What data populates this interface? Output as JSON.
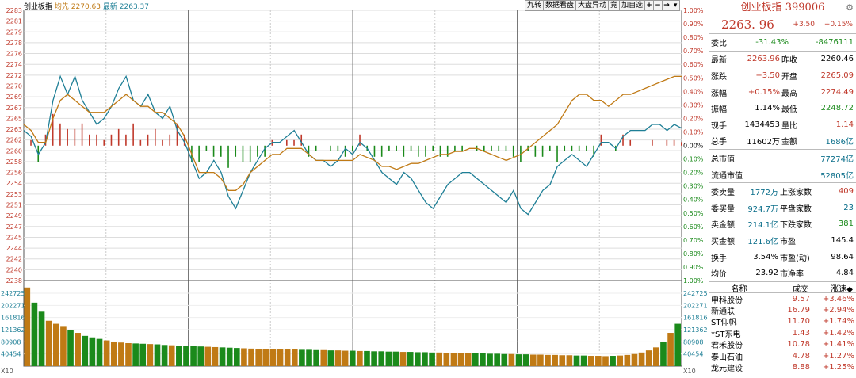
{
  "header": {
    "name_label": "创业板指",
    "avg_label": "均先",
    "avg_value": "2270.63",
    "last_label": "最新",
    "last_value": "2263.37"
  },
  "toolbar": {
    "items": [
      "九转",
      "数据看盘",
      "大盘异动",
      "竞",
      "加自选",
      "+",
      "−",
      "→",
      "▾"
    ]
  },
  "price_axis": {
    "left_labels": [
      "2283",
      "2281",
      "2279",
      "2278",
      "2276",
      "2274",
      "2272",
      "2270",
      "2269",
      "2267",
      "2265",
      "2263",
      "2262",
      "2260",
      "2258",
      "2256",
      "2254",
      "2253",
      "2251",
      "2249",
      "2247",
      "2245",
      "2244",
      "2242",
      "2240",
      "2238"
    ],
    "right_labels": [
      "1.00%",
      "0.90%",
      "0.80%",
      "0.70%",
      "0.60%",
      "0.50%",
      "0.40%",
      "0.30%",
      "0.20%",
      "0.10%",
      "0.00%",
      "0.10%",
      "0.20%",
      "0.30%",
      "0.40%",
      "0.50%",
      "0.60%",
      "0.70%",
      "0.80%",
      "0.90%",
      "1.00%"
    ]
  },
  "volume_axis": {
    "labels": [
      "242725",
      "202271",
      "161816",
      "121362",
      "80908",
      "40454"
    ],
    "unit_left": "X10",
    "unit_right": "X10"
  },
  "chart_data": {
    "type": "line",
    "pre_close": 2260.46,
    "ylim": [
      2238,
      2283
    ],
    "series": [
      {
        "name": "最新",
        "color": "#1e7f96",
        "values": [
          2263.0,
          2262.0,
          2259.0,
          2261.0,
          2268.0,
          2272.0,
          2269.0,
          2272.0,
          2268.0,
          2266.0,
          2264.0,
          2265.0,
          2267.0,
          2270.0,
          2272.0,
          2268.0,
          2267.0,
          2269.0,
          2266.0,
          2265.0,
          2267.0,
          2263.0,
          2261.0,
          2258.0,
          2255.0,
          2256.0,
          2258.0,
          2256.0,
          2252.0,
          2250.0,
          2253.0,
          2256.0,
          2258.0,
          2260.0,
          2261.0,
          2261.0,
          2262.0,
          2263.0,
          2261.0,
          2259.0,
          2258.0,
          2258.0,
          2257.0,
          2258.0,
          2260.0,
          2259.0,
          2261.0,
          2260.0,
          2258.0,
          2256.0,
          2255.0,
          2254.0,
          2256.0,
          2255.0,
          2253.0,
          2251.0,
          2250.0,
          2252.0,
          2254.0,
          2255.0,
          2256.0,
          2256.0,
          2255.0,
          2254.0,
          2253.0,
          2252.0,
          2251.0,
          2253.0,
          2250.0,
          2249.0,
          2251.0,
          2253.0,
          2254.0,
          2257.0,
          2258.0,
          2259.0,
          2258.0,
          2257.0,
          2259.0,
          2261.0,
          2261.0,
          2260.0,
          2262.0,
          2263.0,
          2263.0,
          2263.0,
          2264.0,
          2264.0,
          2263.0,
          2264.0,
          2263.37
        ]
      },
      {
        "name": "均先",
        "color": "#c07a15",
        "values": [
          2264.0,
          2263.0,
          2261.0,
          2261.0,
          2265.0,
          2268.0,
          2269.0,
          2268.0,
          2267.0,
          2266.0,
          2266.0,
          2266.0,
          2267.0,
          2268.0,
          2269.0,
          2268.0,
          2267.0,
          2267.0,
          2266.0,
          2266.0,
          2265.0,
          2264.0,
          2262.0,
          2259.0,
          2256.0,
          2256.0,
          2256.0,
          2255.0,
          2253.0,
          2253.0,
          2254.0,
          2256.0,
          2257.0,
          2258.0,
          2259.0,
          2259.0,
          2260.0,
          2260.0,
          2260.0,
          2259.0,
          2258.0,
          2258.0,
          2258.0,
          2258.0,
          2258.0,
          2258.0,
          2259.0,
          2258.5,
          2258.0,
          2257.0,
          2257.0,
          2256.5,
          2257.0,
          2257.5,
          2257.5,
          2258.0,
          2258.5,
          2259.0,
          2259.0,
          2259.5,
          2259.5,
          2260.0,
          2260.0,
          2259.5,
          2259.0,
          2258.5,
          2258.0,
          2258.5,
          2259.0,
          2260.0,
          2261.0,
          2262.0,
          2263.0,
          2264.0,
          2266.0,
          2268.0,
          2269.0,
          2269.0,
          2268.0,
          2268.0,
          2267.0,
          2268.0,
          2269.0,
          2269.0,
          2269.5,
          2270.0,
          2270.5,
          2271.0,
          2271.5,
          2272.0,
          2272.0
        ]
      }
    ],
    "volume_values": [
      260000,
      210000,
      180000,
      150000,
      140000,
      130000,
      120000,
      110000,
      100000,
      95000,
      90000,
      85000,
      80000,
      78000,
      76000,
      75000,
      74000,
      73000,
      72000,
      70000,
      69000,
      68000,
      67000,
      66000,
      65000,
      64000,
      63000,
      62000,
      61000,
      60000,
      59000,
      58000,
      57000,
      57000,
      56000,
      56000,
      55000,
      55000,
      54000,
      54000,
      53000,
      53000,
      52000,
      52000,
      51000,
      51000,
      50000,
      50000,
      49000,
      49000,
      48000,
      48000,
      47000,
      47000,
      46000,
      46000,
      45000,
      45000,
      44000,
      44000,
      43000,
      43000,
      42000,
      42000,
      41000,
      41000,
      40000,
      40000,
      39000,
      39000,
      38000,
      38000,
      37000,
      37000,
      36000,
      36000,
      35000,
      35000,
      34000,
      34000,
      33000,
      34000,
      35000,
      37000,
      40000,
      45000,
      52000,
      62000,
      80000,
      110000,
      140000
    ],
    "ylim_volume": [
      0,
      283000
    ]
  },
  "panel": {
    "title": "创业板指 399006",
    "price": "2263. 96",
    "change": "+3.50",
    "change_pct": "+0.15%",
    "wei_label": "委比",
    "wei_pct": "-31.43%",
    "wei_diff": "-8476111",
    "stats": [
      {
        "l1": "最新",
        "v1": "2263.96",
        "c1": "red",
        "l2": "昨收",
        "v2": "2260.46",
        "c2": "blk"
      },
      {
        "l1": "涨跌",
        "v1": "+3.50",
        "c1": "red",
        "l2": "开盘",
        "v2": "2265.09",
        "c2": "red"
      },
      {
        "l1": "涨幅",
        "v1": "+0.15%",
        "c1": "red",
        "l2": "最高",
        "v2": "2274.49",
        "c2": "red"
      },
      {
        "l1": "振幅",
        "v1": "1.14%",
        "c1": "blk",
        "l2": "最低",
        "v2": "2248.72",
        "c2": "green"
      },
      {
        "l1": "现手",
        "v1": "1434453",
        "c1": "blk",
        "l2": "量比",
        "v2": "1.14",
        "c2": "red"
      },
      {
        "l1": "总手",
        "v1": "11602万",
        "c1": "blk",
        "l2": "金额",
        "v2": "1686亿",
        "c2": "teal"
      }
    ],
    "cap": [
      {
        "l": "总市值",
        "v": "77274亿"
      },
      {
        "l": "流通市值",
        "v": "52805亿"
      }
    ],
    "stats2": [
      {
        "l1": "委卖量",
        "v1": "1772万",
        "c1": "teal",
        "l2": "上涨家数",
        "v2": "409",
        "c2": "red"
      },
      {
        "l1": "委买量",
        "v1": "924.7万",
        "c1": "teal",
        "l2": "平盘家数",
        "v2": "23",
        "c2": "teal"
      },
      {
        "l1": "卖金额",
        "v1": "214.1亿",
        "c1": "teal",
        "l2": "下跌家数",
        "v2": "381",
        "c2": "green"
      },
      {
        "l1": "买金额",
        "v1": "121.6亿",
        "c1": "teal",
        "l2": "市盈",
        "v2": "145.4",
        "c2": "blk"
      },
      {
        "l1": "换手",
        "v1": "3.54%",
        "c1": "blk",
        "l2": "市盈(动)",
        "v2": "98.64",
        "c2": "blk"
      },
      {
        "l1": "均价",
        "v1": "23.92",
        "c1": "blk",
        "l2": "市净率",
        "v2": "4.84",
        "c2": "blk"
      }
    ],
    "list_head": {
      "name": "名称",
      "price": "成交",
      "change": "涨速◆"
    },
    "list": [
      {
        "name": "申科股份",
        "price": "9.57",
        "change": "+3.46%"
      },
      {
        "name": "新通联",
        "price": "16.79",
        "change": "+2.94%"
      },
      {
        "name": "ST仰帆",
        "price": "11.70",
        "change": "+1.74%"
      },
      {
        "name": "*ST东电",
        "price": "1.43",
        "change": "+1.42%"
      },
      {
        "name": "君禾股份",
        "price": "10.78",
        "change": "+1.41%"
      },
      {
        "name": "泰山石油",
        "price": "4.78",
        "change": "+1.27%"
      },
      {
        "name": "龙元建设",
        "price": "8.88",
        "change": "+1.25%"
      }
    ]
  }
}
